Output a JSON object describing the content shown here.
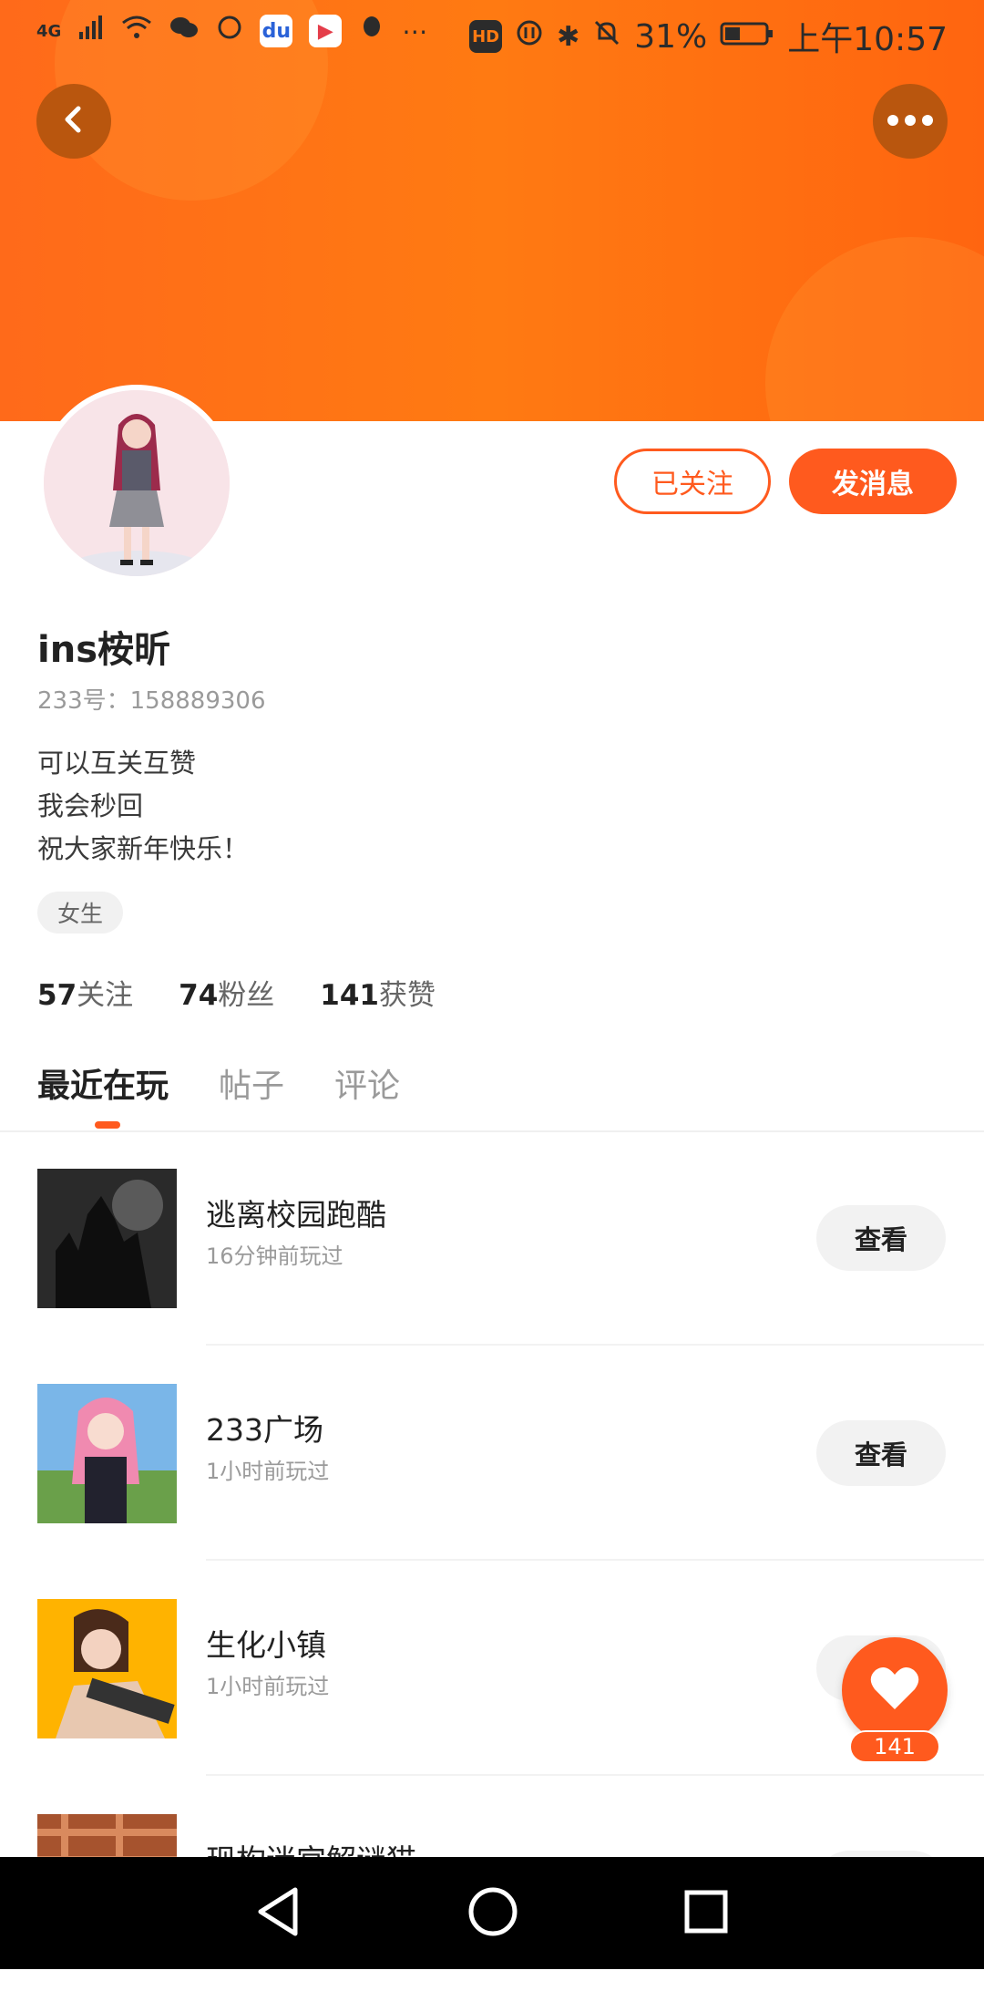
{
  "status": {
    "left_text": "4G",
    "battery": "31%",
    "time": "上午10:57",
    "hd": "HD"
  },
  "profile": {
    "name": "ins桉昕",
    "uid": "233号：158889306",
    "bio": [
      "可以互关互赞",
      "我会秒回",
      "祝大家新年快乐！"
    ],
    "tag": "女生"
  },
  "actions": {
    "follow_label": "已关注",
    "message_label": "发消息"
  },
  "stats": {
    "following_num": "57",
    "following_label": "关注",
    "fans_num": "74",
    "fans_label": "粉丝",
    "likes_num": "141",
    "likes_label": "获赞"
  },
  "tabs": [
    {
      "label": "最近在玩"
    },
    {
      "label": "帖子"
    },
    {
      "label": "评论"
    }
  ],
  "games": [
    {
      "title": "逃离校园跑酷",
      "sub": "16分钟前玩过",
      "button": "查看"
    },
    {
      "title": "233广场",
      "sub": "1小时前玩过",
      "button": "查看"
    },
    {
      "title": "生化小镇",
      "sub": "1小时前玩过",
      "button": "查看"
    },
    {
      "title": "现构迷宫解谜猫",
      "sub": "",
      "button": "查看"
    }
  ],
  "fab": {
    "count": "141"
  },
  "colors": {
    "accent": "#ff5a1e",
    "header": "#ff7a12"
  }
}
